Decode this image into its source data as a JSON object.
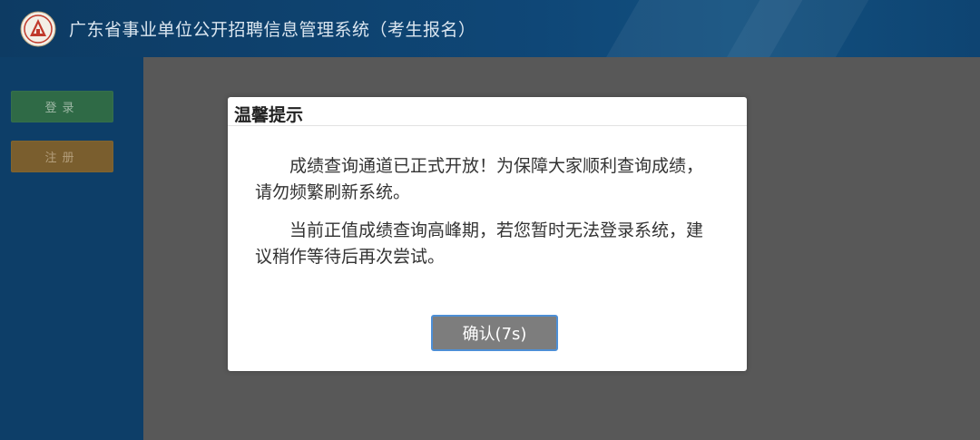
{
  "header": {
    "title": "广东省事业单位公开招聘信息管理系统（考生报名）",
    "logo_icon": "emblem-logo-icon"
  },
  "sidebar": {
    "login_label": "登录",
    "register_label": "注册"
  },
  "dialog": {
    "title": "温馨提示",
    "paragraphs": [
      "成绩查询通道已正式开放！为保障大家顺利查询成绩，请勿频繁刷新系统。",
      "当前正值成绩查询高峰期，若您暂时无法登录系统，建议稍作等待后再次尝试。"
    ],
    "confirm_label": "确认(7s)"
  },
  "colors": {
    "header_bg": "#0f4777",
    "sidebar_bg": "#0d3e68",
    "overlay_bg": "#585858",
    "login_btn": "#2f6a46",
    "register_btn": "#7a5e2e",
    "confirm_btn": "#7d7d7d",
    "confirm_border": "#4d8fd6"
  }
}
